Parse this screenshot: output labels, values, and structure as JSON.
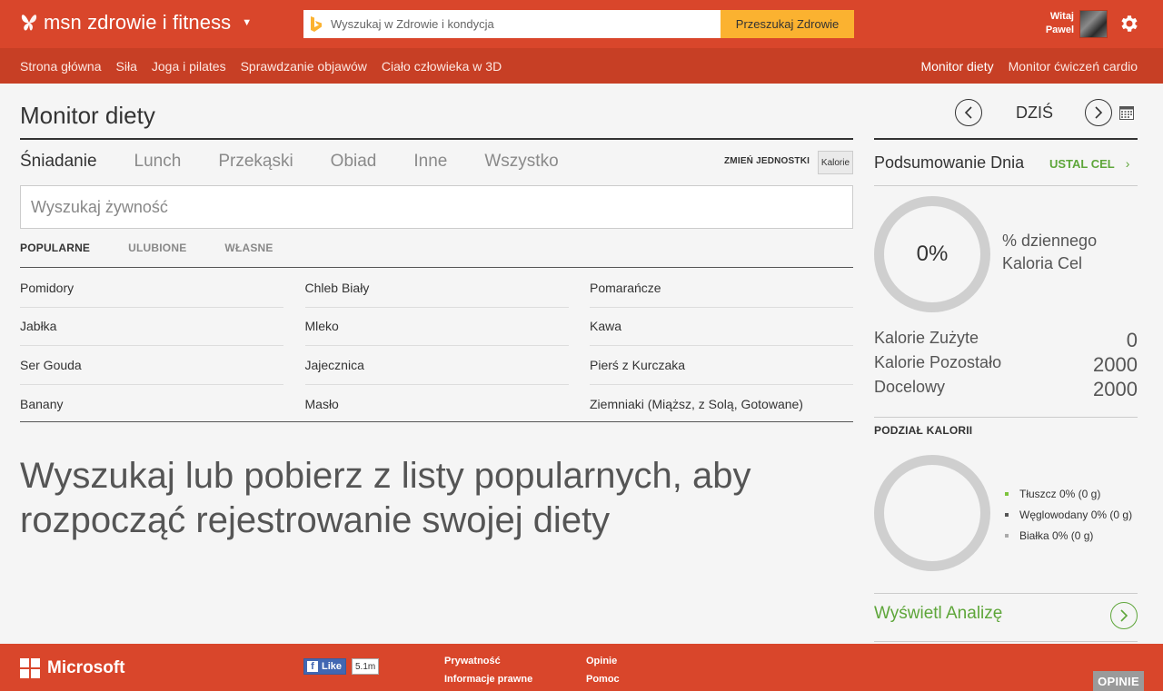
{
  "header": {
    "brand": "msn zdrowie i fitness",
    "search_placeholder": "Wyszukaj w Zdrowie i kondycja",
    "search_button": "Przeszukaj Zdrowie",
    "greeting_line1": "Witaj",
    "greeting_line2": "Pawel"
  },
  "nav": {
    "left": [
      "Strona główna",
      "Siła",
      "Joga i pilates",
      "Sprawdzanie objawów",
      "Ciało człowieka w 3D"
    ],
    "right": [
      "Monitor diety",
      "Monitor ćwiczeń cardio"
    ],
    "active": "Monitor diety"
  },
  "main": {
    "title": "Monitor diety",
    "meal_tabs": [
      "Śniadanie",
      "Lunch",
      "Przekąski",
      "Obiad",
      "Inne",
      "Wszystko"
    ],
    "active_meal_tab": "Śniadanie",
    "change_units_label": "ZMIEŃ JEDNOSTKI",
    "units_button": "Kalorie",
    "food_search_placeholder": "Wyszukaj żywność",
    "list_tabs": [
      "POPULARNE",
      "ULUBIONE",
      "WŁASNE"
    ],
    "active_list_tab": "POPULARNE",
    "foods": [
      [
        "Pomidory",
        "Chleb Biały",
        "Pomarańcze"
      ],
      [
        "Jabłka",
        "Mleko",
        "Kawa"
      ],
      [
        "Ser Gouda",
        "Jajecznica",
        "Pierś z Kurczaka"
      ],
      [
        "Banany",
        "Masło",
        "Ziemniaki (Miąższ, z Solą, Gotowane)"
      ]
    ],
    "empty_message": "Wyszukaj lub pobierz z listy popularnych, aby rozpocząć rejestrowanie swojej diety"
  },
  "summary": {
    "date_label": "DZIŚ",
    "title": "Podsumowanie Dnia",
    "set_goal": "USTAL CEL",
    "percent": "0%",
    "percent_caption_line1": "% dziennego",
    "percent_caption_line2": "Kaloria Cel",
    "stats": [
      {
        "label": "Kalorie Zużyte",
        "value": "0"
      },
      {
        "label": "Kalorie Pozostało",
        "value": "2000"
      },
      {
        "label": "Docelowy",
        "value": "2000"
      }
    ],
    "breakdown_title": "PODZIAŁ KALORII",
    "legend": [
      {
        "label": "Tłuszcz 0% (0 g)",
        "color": "#7cc33c"
      },
      {
        "label": "Węglowodany 0% (0 g)",
        "color": "#555555"
      },
      {
        "label": "Białka 0% (0 g)",
        "color": "#aaaaaa"
      }
    ],
    "view_analysis": "Wyświetl Analizę"
  },
  "footer": {
    "brand": "Microsoft",
    "like_label": "Like",
    "like_count": "5.1m",
    "links": [
      "Prywatność",
      "Informacje prawne",
      "Opinie",
      "Pomoc"
    ],
    "feedback_button": "OPINIE"
  },
  "colors": {
    "brand_orange": "#d9462b",
    "nav_orange": "#c73f25",
    "search_yellow": "#fbb230",
    "accent_green": "#5ea63a"
  }
}
